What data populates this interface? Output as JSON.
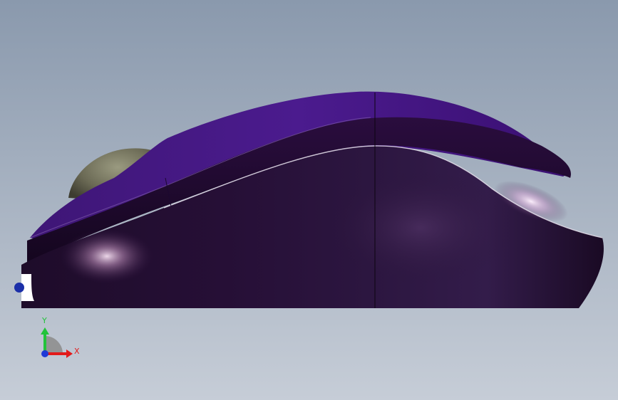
{
  "viewport": {
    "background_top": "#8a99ad",
    "background_bottom": "#c6cdd7"
  },
  "model": {
    "shell_dark": "#1a0a26",
    "shell_mid": "#2e1844",
    "purple_top": "#4a1a8a",
    "purple_bright": "#5a24a8",
    "wheel_color": "#6b6a55",
    "highlight": "#f4dcf0"
  },
  "triad": {
    "x_label": "X",
    "y_label": "Y",
    "x_color": "#e21b1b",
    "y_color": "#22c33a",
    "z_color": "#1f3ad6"
  }
}
